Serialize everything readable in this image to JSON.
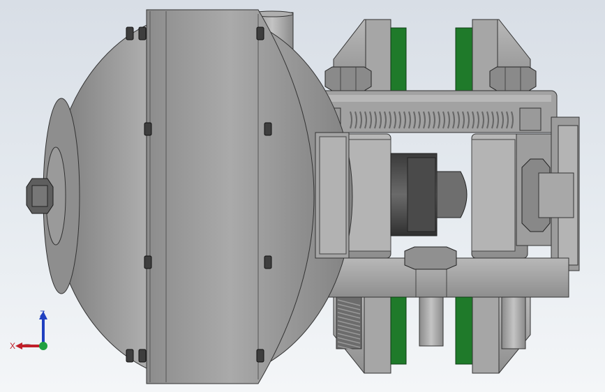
{
  "viewport": {
    "background_top": "#d8dee6",
    "background_bottom": "#f4f6f8"
  },
  "model": {
    "body_color": "#a8a8a8",
    "pad_color": "#1f7a2a",
    "parts": [
      "housing-dome",
      "mounting-bolts",
      "upper-clamp-block",
      "lower-clamp-block",
      "tie-rod",
      "return-spring",
      "brake-pads",
      "base-plate",
      "hex-nuts",
      "guide-pins",
      "braided-cable"
    ]
  },
  "triad": {
    "x_label": "X",
    "z_label": "Z",
    "x_color": "#c0202a",
    "z_color": "#2040c0",
    "y_color": "#20a040"
  }
}
